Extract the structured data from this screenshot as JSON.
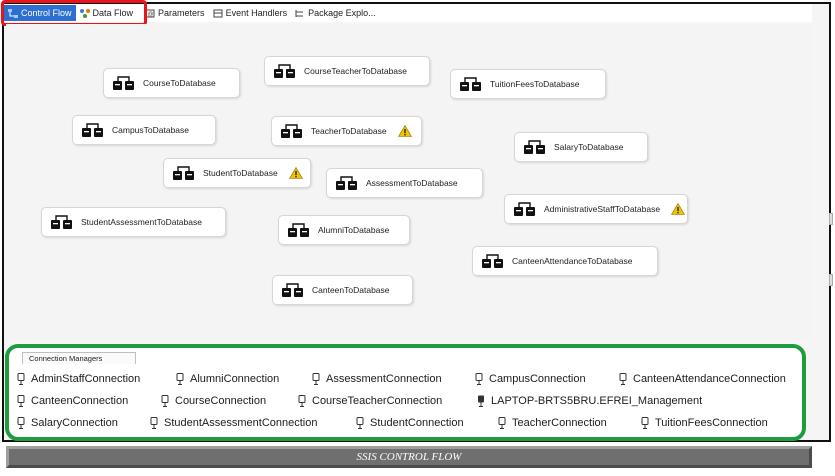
{
  "tabs": [
    {
      "label": "Control Flow",
      "icon": "control-flow-icon",
      "active": true
    },
    {
      "label": "Data Flow",
      "icon": "data-flow-icon",
      "active": false
    },
    {
      "label": "Parameters",
      "icon": "parameters-icon",
      "active": false
    },
    {
      "label": "Event Handlers",
      "icon": "event-handlers-icon",
      "active": false
    },
    {
      "label": "Package Explo...",
      "icon": "package-explorer-icon",
      "active": false
    }
  ],
  "tasks": [
    {
      "label": "CourseToDatabase",
      "warning": false
    },
    {
      "label": "CourseTeacherToDatabase",
      "warning": false
    },
    {
      "label": "TuitionFeesToDatabase",
      "warning": false
    },
    {
      "label": "CampusToDatabase",
      "warning": false
    },
    {
      "label": "TeacherToDatabase",
      "warning": true
    },
    {
      "label": "SalaryToDatabase",
      "warning": false
    },
    {
      "label": "StudentToDatabase",
      "warning": true
    },
    {
      "label": "AssessmentToDatabase",
      "warning": false
    },
    {
      "label": "AdministrativeStaffToDatabase",
      "warning": true
    },
    {
      "label": "StudentAssessmentToDatabase",
      "warning": false
    },
    {
      "label": "AlumniToDatabase",
      "warning": false
    },
    {
      "label": "CanteenAttendanceToDatabase",
      "warning": false
    },
    {
      "label": "CanteenToDatabase",
      "warning": false
    }
  ],
  "connection_managers": {
    "tab_label": "Connection Managers",
    "rows": [
      [
        "AdminStaffConnection",
        "AlumniConnection",
        "AssessmentConnection",
        "CampusConnection",
        "CanteenAttendanceConnection"
      ],
      [
        "CanteenConnection",
        "CourseConnection",
        "CourseTeacherConnection",
        "LAPTOP-BRTS5BRU.EFREI_Management"
      ],
      [
        "SalaryConnection",
        "StudentAssessmentConnection",
        "StudentConnection",
        "TeacherConnection",
        "TuitionFeesConnection"
      ]
    ]
  },
  "caption": "SSIS CONTROL FLOW",
  "colors": {
    "active_tab": "#2c6fd1",
    "tab_highlight": "#e8141b",
    "connections_highlight": "#1f9c40",
    "warning": "#f2c200"
  }
}
